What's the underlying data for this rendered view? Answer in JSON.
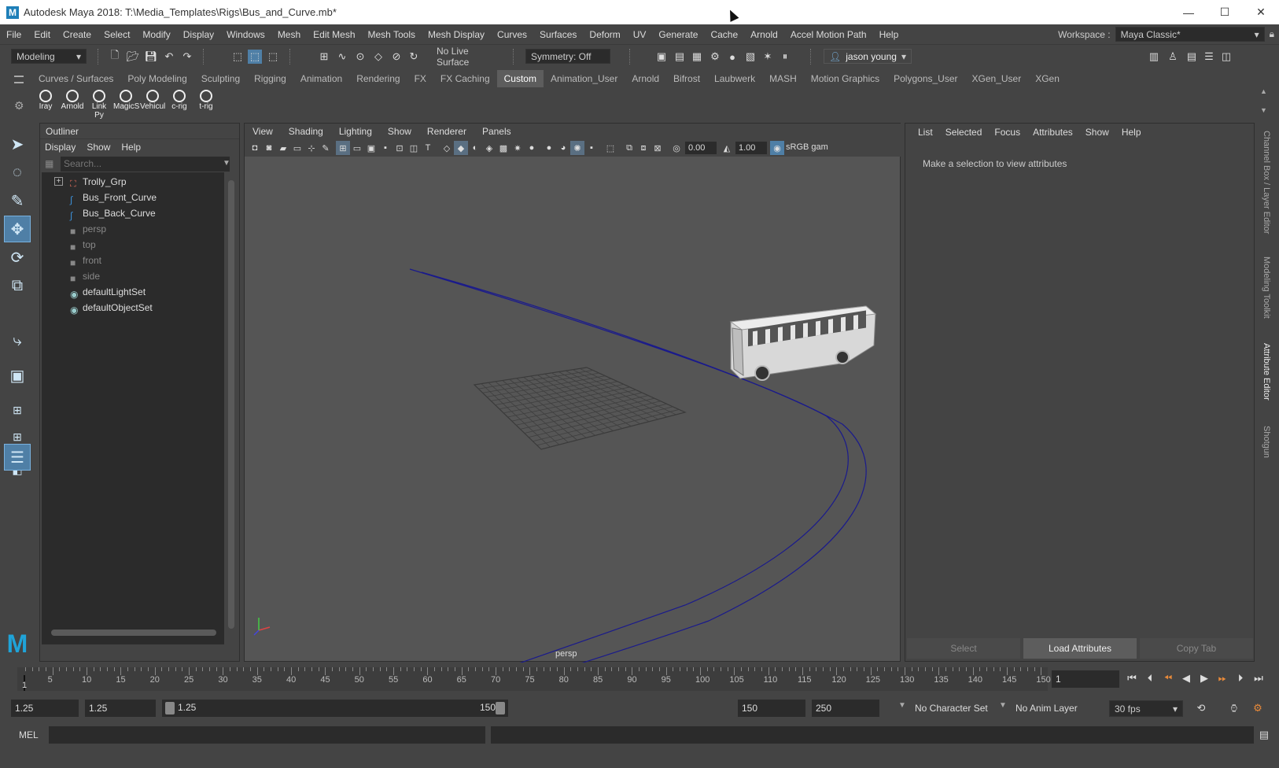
{
  "window": {
    "title": "Autodesk Maya 2018: T:\\Media_Templates\\Rigs\\Bus_and_Curve.mb*",
    "logo": "M",
    "minimize": "—",
    "maximize": "☐",
    "close": "✕"
  },
  "menubar": {
    "items": [
      "File",
      "Edit",
      "Create",
      "Select",
      "Modify",
      "Display",
      "Windows",
      "Mesh",
      "Edit Mesh",
      "Mesh Tools",
      "Mesh Display",
      "Curves",
      "Surfaces",
      "Deform",
      "UV",
      "Generate",
      "Cache",
      "Arnold",
      "Accel Motion Path",
      "Help"
    ],
    "workspace_label": "Workspace :",
    "workspace_value": "Maya Classic*"
  },
  "statusline": {
    "mode": "Modeling",
    "live_surface": "No Live Surface",
    "symmetry": "Symmetry: Off",
    "user": "jason young"
  },
  "shelf": {
    "tabs": [
      "Curves / Surfaces",
      "Poly Modeling",
      "Sculpting",
      "Rigging",
      "Animation",
      "Rendering",
      "FX",
      "FX Caching",
      "Custom",
      "Animation_User",
      "Arnold",
      "Bifrost",
      "Laubwerk",
      "MASH",
      "Motion Graphics",
      "Polygons_User",
      "XGen_User",
      "XGen"
    ],
    "active_tab": "Custom",
    "buttons": [
      "Iray",
      "Arnold",
      "Link Py",
      "MagicS",
      "Vehicul",
      "c-rig",
      "t-rig"
    ]
  },
  "outliner": {
    "title": "Outliner",
    "menu": [
      "Display",
      "Show",
      "Help"
    ],
    "search_placeholder": "Search...",
    "items": [
      {
        "label": "Trolly_Grp",
        "icon": "group-icon",
        "dim": false,
        "expand": "+"
      },
      {
        "label": "Bus_Front_Curve",
        "icon": "curve-icon",
        "dim": false
      },
      {
        "label": "Bus_Back_Curve",
        "icon": "curve-icon",
        "dim": false
      },
      {
        "label": "persp",
        "icon": "camera-icon",
        "dim": true
      },
      {
        "label": "top",
        "icon": "camera-icon",
        "dim": true
      },
      {
        "label": "front",
        "icon": "camera-icon",
        "dim": true
      },
      {
        "label": "side",
        "icon": "camera-icon",
        "dim": true
      },
      {
        "label": "defaultLightSet",
        "icon": "set-icon",
        "dim": false
      },
      {
        "label": "defaultObjectSet",
        "icon": "set-icon",
        "dim": false
      }
    ]
  },
  "viewport": {
    "menu": [
      "View",
      "Shading",
      "Lighting",
      "Show",
      "Renderer",
      "Panels"
    ],
    "exposure": "0.00",
    "gamma": "1.00",
    "color_space": "sRGB gam",
    "camera_label": "persp",
    "curve_color": "#1a1a8c"
  },
  "attribute_editor": {
    "menu": [
      "List",
      "Selected",
      "Focus",
      "Attributes",
      "Show",
      "Help"
    ],
    "message": "Make a selection to view attributes",
    "buttons": {
      "select": "Select",
      "load": "Load Attributes",
      "copy": "Copy Tab"
    }
  },
  "right_tabs": [
    "Channel Box / Layer Editor",
    "Modeling Toolkit",
    "Attribute Editor",
    "Shotgun"
  ],
  "right_tabs_active": "Attribute Editor",
  "timeslider": {
    "labels": [
      "5",
      "10",
      "15",
      "20",
      "25",
      "30",
      "35",
      "40",
      "45",
      "50",
      "55",
      "60",
      "65",
      "70",
      "75",
      "80",
      "85",
      "90",
      "95",
      "100",
      "105",
      "110",
      "115",
      "120",
      "125",
      "130",
      "135",
      "140",
      "145",
      "150"
    ],
    "start_marker": "1",
    "current_frame": "1"
  },
  "rangebar": {
    "start": "1.25",
    "anim_start": "1.25",
    "range_start": "1.25",
    "range_end": "150",
    "anim_end_a": "150",
    "anim_end_b": "250",
    "character_set": "No Character Set",
    "anim_layer": "No Anim Layer",
    "fps": "30 fps"
  },
  "cmdline": {
    "label": "MEL"
  }
}
